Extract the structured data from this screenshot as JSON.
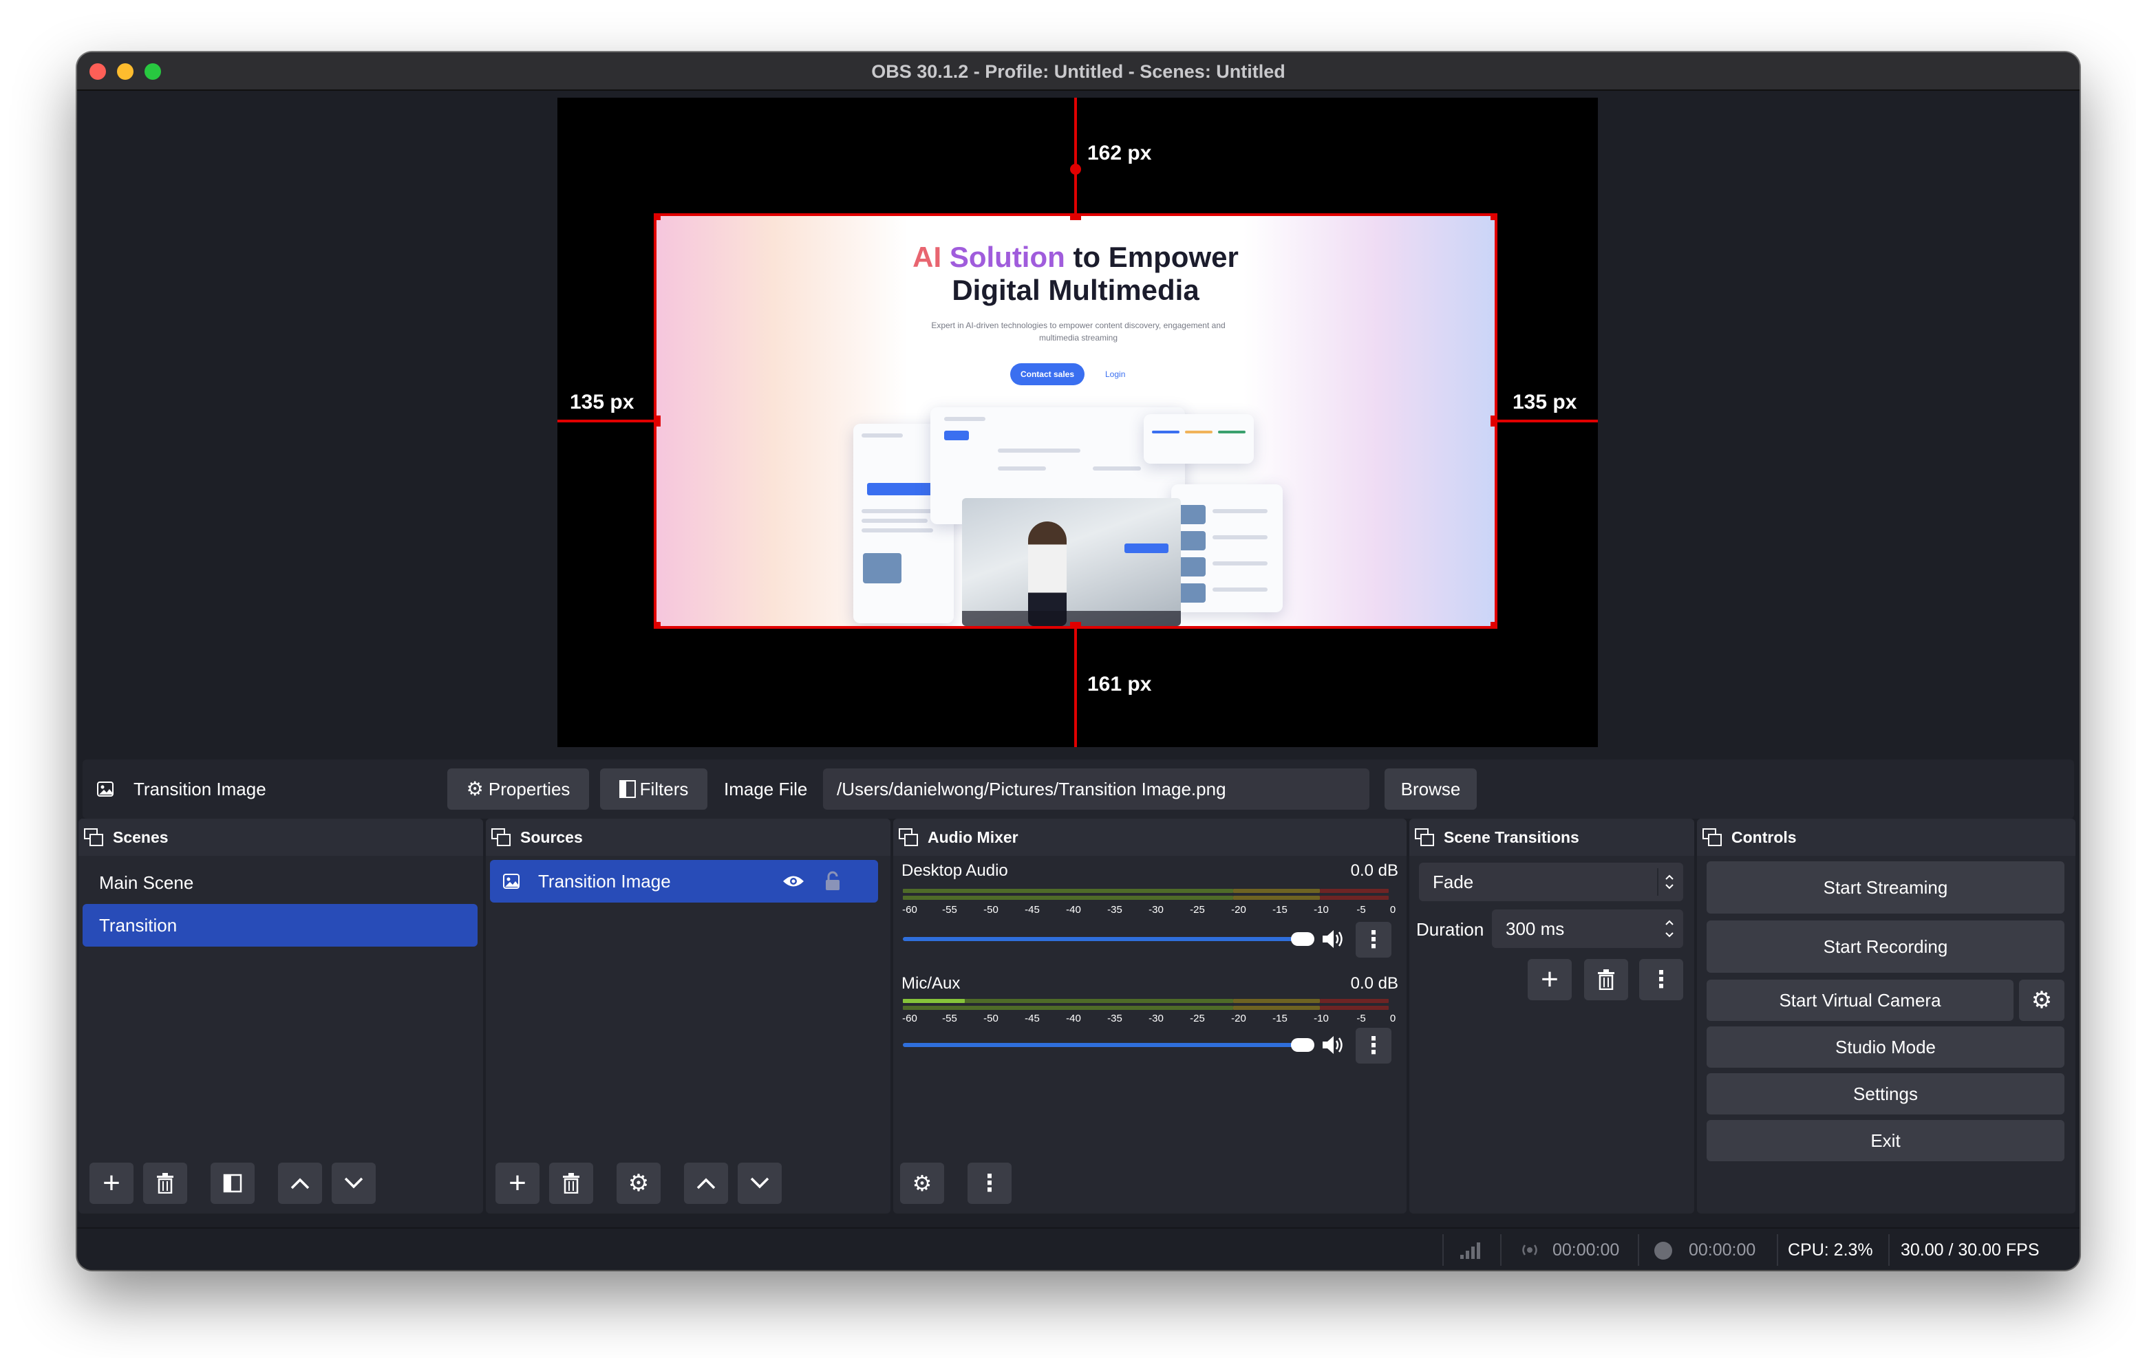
{
  "window": {
    "title": "OBS 30.1.2 - Profile: Untitled - Scenes: Untitled"
  },
  "preview": {
    "top_distance": "162 px",
    "bottom_distance": "161 px",
    "left_distance": "135 px",
    "right_distance": "135 px",
    "image": {
      "headline_ai": "AI",
      "headline_solution": "Solution",
      "headline_rest": "to Empower",
      "headline_line2": "Digital Multimedia",
      "subtext": "Expert in AI-driven technologies to empower content discovery, engagement and multimedia streaming",
      "contact_label": "Contact sales",
      "login_label": "Login"
    }
  },
  "properties_bar": {
    "source_name": "Transition Image",
    "properties_label": "Properties",
    "filters_label": "Filters",
    "image_file_label": "Image File",
    "image_file_path": "/Users/danielwong/Pictures/Transition Image.png",
    "browse_label": "Browse",
    "icons": {
      "source": "image-icon",
      "properties": "gear-icon",
      "filters": "filter-icon"
    }
  },
  "scenes": {
    "title": "Scenes",
    "items": [
      {
        "label": "Main Scene",
        "selected": false
      },
      {
        "label": "Transition",
        "selected": true
      }
    ],
    "toolbar_icons": [
      "plus-icon",
      "trash-icon",
      "filter-icon",
      "chevron-up-icon",
      "chevron-down-icon"
    ]
  },
  "sources": {
    "title": "Sources",
    "items": [
      {
        "label": "Transition Image",
        "visible": true,
        "locked": false
      }
    ],
    "toolbar_icons": [
      "plus-icon",
      "trash-icon",
      "gear-icon",
      "chevron-up-icon",
      "chevron-down-icon"
    ]
  },
  "audio_mixer": {
    "title": "Audio Mixer",
    "ticks": [
      "-60",
      "-55",
      "-50",
      "-45",
      "-40",
      "-35",
      "-30",
      "-25",
      "-20",
      "-15",
      "-10",
      "-5",
      "0"
    ],
    "channels": [
      {
        "name": "Desktop Audio",
        "level": "0.0 dB",
        "volume_fraction": 0.97
      },
      {
        "name": "Mic/Aux",
        "level": "0.0 dB",
        "volume_fraction": 0.97
      }
    ],
    "toolbar_icons": [
      "advanced-audio-icon",
      "more-vertical-icon"
    ]
  },
  "scene_transitions": {
    "title": "Scene Transitions",
    "transition": "Fade",
    "duration_label": "Duration",
    "duration_value": "300 ms"
  },
  "controls": {
    "title": "Controls",
    "start_streaming": "Start Streaming",
    "start_recording": "Start Recording",
    "start_virtual_camera": "Start Virtual Camera",
    "studio_mode": "Studio Mode",
    "settings": "Settings",
    "exit": "Exit"
  },
  "status_bar": {
    "stream_time": "00:00:00",
    "record_time": "00:00:00",
    "cpu": "CPU: 2.3%",
    "fps": "30.00 / 30.00 FPS"
  },
  "colors": {
    "accent_blue": "#284cb8",
    "guide_red": "#e00000",
    "background": "#1d1f26",
    "button": "#3b3d46"
  }
}
